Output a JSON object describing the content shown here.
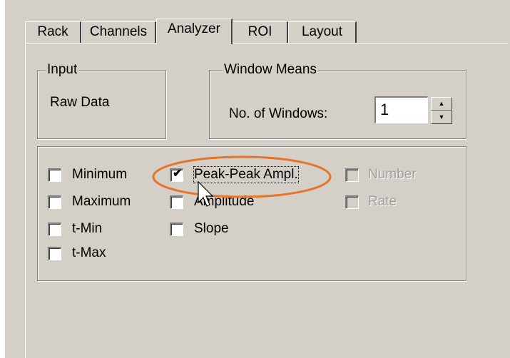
{
  "tabs": [
    {
      "label": "Rack"
    },
    {
      "label": "Channels"
    },
    {
      "label": "Analyzer"
    },
    {
      "label": "ROI"
    },
    {
      "label": "Layout"
    }
  ],
  "active_tab": "Analyzer",
  "input_group": {
    "legend": "Input",
    "value": "Raw Data"
  },
  "window_means": {
    "legend": "Window Means",
    "label": "No. of Windows:",
    "value": "1",
    "spin_up_icon": "triangle-up-icon",
    "spin_down_icon": "triangle-down-icon"
  },
  "checkboxes": {
    "minimum": {
      "label": "Minimum",
      "checked": false,
      "enabled": true
    },
    "maximum": {
      "label": "Maximum",
      "checked": false,
      "enabled": true
    },
    "t_min": {
      "label": "t-Min",
      "checked": false,
      "enabled": true
    },
    "t_max": {
      "label": "t-Max",
      "checked": false,
      "enabled": true
    },
    "peak_peak": {
      "label": "Peak-Peak Ampl.",
      "checked": true,
      "enabled": true
    },
    "amplitude": {
      "label": "Amplitude",
      "checked": false,
      "enabled": true
    },
    "slope": {
      "label": "Slope",
      "checked": false,
      "enabled": true
    },
    "number": {
      "label": "Number",
      "checked": false,
      "enabled": false
    },
    "rate": {
      "label": "Rate",
      "checked": false,
      "enabled": false
    }
  },
  "highlight_color": "#e8742a"
}
